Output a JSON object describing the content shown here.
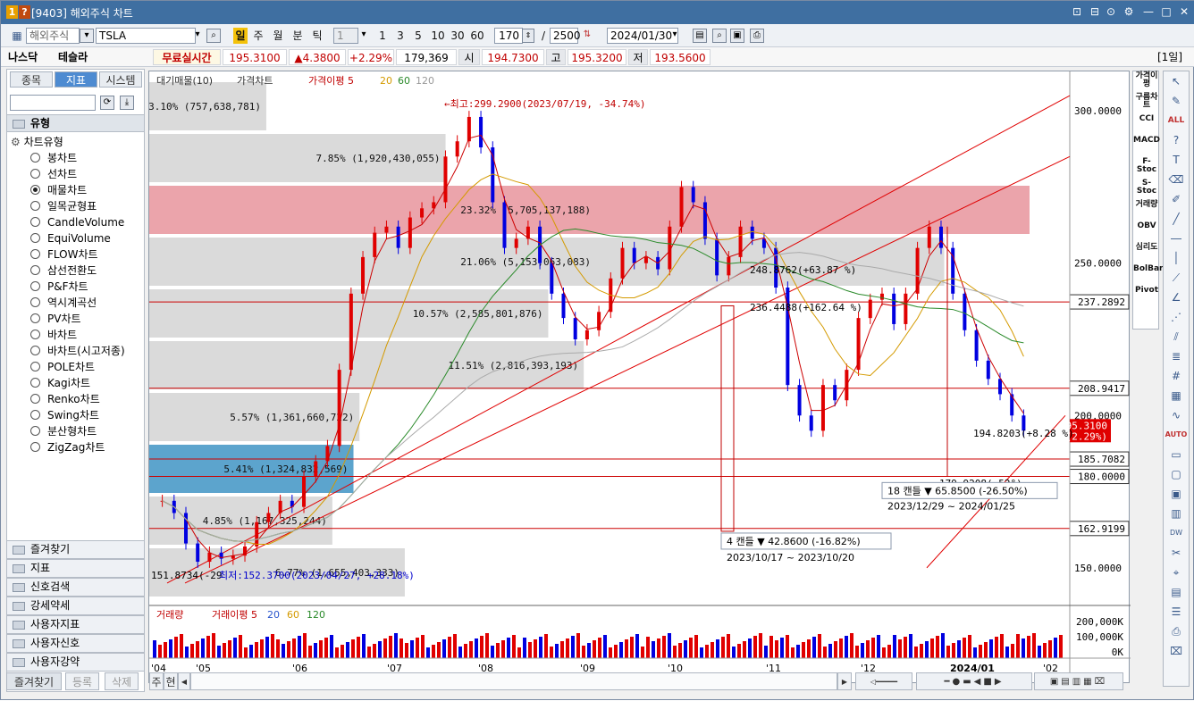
{
  "window": {
    "title": "[9403] 해외주식 차트",
    "badge1": "1",
    "badge2": "?",
    "controls": [
      "⊡",
      "⊟",
      "⊙",
      "⚙",
      "—",
      "□",
      "✕"
    ]
  },
  "toolbar": {
    "market": "해외주식",
    "symbol": "TSLA",
    "period_btn": "일",
    "periods": [
      "주",
      "월",
      "분",
      "틱"
    ],
    "count_sel": "1",
    "nums": [
      "1",
      "3",
      "5",
      "10",
      "30",
      "60"
    ],
    "view": "170",
    "total": "2500",
    "date": "2024/01/30"
  },
  "quote": {
    "exchange": "나스닥",
    "name": "테슬라",
    "realtime": "무료실시간",
    "price": "195.3100",
    "change": "▲4.3800",
    "pct": "+2.29%",
    "volume": "179,369",
    "open_lbl": "시",
    "open": "194.7300",
    "high_lbl": "고",
    "high": "195.3200",
    "low_lbl": "저",
    "low": "193.5600",
    "interval": "[1일]"
  },
  "left": {
    "tabs": [
      "종목",
      "지표",
      "시스템"
    ],
    "group": "유형",
    "root": "차트유형",
    "types": [
      "봉차트",
      "선차트",
      "매물차트",
      "일목균형표",
      "CandleVolume",
      "EquiVolume",
      "FLOW차트",
      "삼선전환도",
      "P&F차트",
      "역시계곡선",
      "PV차트",
      "바차트",
      "바차트(시고저종)",
      "POLE차트",
      "Kagi차트",
      "Renko차트",
      "Swing차트",
      "분산형차트",
      "ZigZag차트"
    ],
    "selected": 2,
    "menus": [
      "즐겨찾기",
      "지표",
      "신호검색",
      "강세약세",
      "사용자지표",
      "사용자신호",
      "사용자강약"
    ]
  },
  "chart_data": {
    "type": "candlestick",
    "legend_top": [
      "대기매물(10)",
      "가격차트",
      "가격이평 5",
      "20",
      "60",
      "120"
    ],
    "legend_bottom": [
      "거래량",
      "거래이평 5",
      "20",
      "60",
      "120"
    ],
    "price_axis": [
      "300.0000",
      "250.0000",
      "200.0000",
      "150.0000"
    ],
    "price_tags": [
      {
        "label": "237.2892",
        "v": 237.29
      },
      {
        "label": "208.9417",
        "v": 208.94
      },
      {
        "label": "185.7082",
        "v": 185.71
      },
      {
        "label": "180.0000",
        "v": 180
      },
      {
        "label": "162.9199",
        "v": 162.92
      }
    ],
    "current_price": "195.3100",
    "current_pct": "(2.29%)",
    "volume_axis": [
      "200,000K",
      "100,000K",
      "0K"
    ],
    "x_labels": [
      "'04",
      "'05",
      "'06",
      "'07",
      "'08",
      "'09",
      "'10",
      "'11",
      "'12",
      "2024/01",
      "'02"
    ],
    "profile": [
      {
        "label": "6.77% (1,655,403,333)",
        "pct": 6.77
      },
      {
        "label": "4.85% (1,167,325,244)",
        "pct": 4.85
      },
      {
        "label": "5.41% (1,324,832,569)",
        "pct": 5.41
      },
      {
        "label": "5.57% (1,361,660,722)",
        "pct": 5.57
      },
      {
        "label": "11.51% (2,816,393,193)",
        "pct": 11.51
      },
      {
        "label": "10.57% (2,585,801,876)",
        "pct": 10.57
      },
      {
        "label": "21.06% (5,153,063,083)",
        "pct": 21.06
      },
      {
        "label": "23.32% (5,705,137,188)",
        "pct": 23.32
      },
      {
        "label": "7.85% (1,920,430,055)",
        "pct": 7.85
      },
      {
        "label": "3.10% (757,638,781)",
        "pct": 3.1
      }
    ],
    "annotations": {
      "high": "←최고:299.2900(2023/07/19, -34.74%)",
      "low": "151.8734(-29",
      "low2": "최저:152.3700(2023/04/27, +28.18%)",
      "p1": "248.8762(+63.87 %)",
      "p2": "236.4488(+162.64 %)",
      "p3": "194.8203(+8.28 %)",
      "p4": "179.9208(-52°)",
      "box1a": "4 캔들  ▼ 42.8600 (-16.82%)",
      "box1b": "2023/10/17 ~ 2023/10/20",
      "box2a": "18 캔들  ▼ 65.8500 (-26.50%)",
      "box2b": "2023/12/29 ~ 2024/01/25"
    },
    "prices": [
      172,
      168,
      158,
      152,
      155,
      153,
      154,
      157,
      165,
      168,
      172,
      170,
      180,
      185,
      190,
      215,
      240,
      252,
      260,
      262,
      255,
      265,
      268,
      270,
      285,
      290,
      298,
      288,
      270,
      255,
      258,
      262,
      250,
      240,
      232,
      225,
      228,
      234,
      245,
      255,
      250,
      252,
      248,
      262,
      275,
      270,
      258,
      246,
      252,
      262,
      258,
      255,
      242,
      210,
      200,
      195,
      210,
      205,
      215,
      232,
      238,
      240,
      230,
      240,
      255,
      262,
      255,
      240,
      228,
      218,
      212,
      207,
      200,
      195
    ]
  },
  "bottom": {
    "left_btns": [
      "즐겨찾기",
      "등록",
      "삭제"
    ],
    "pager": [
      "주",
      "현"
    ]
  },
  "right_tools": [
    "가격이평",
    "구름차트",
    "CCI",
    "MACD",
    "F-Stoc",
    "S-Stoc",
    "거래량",
    "OBV",
    "심리도",
    "BolBand",
    "Pivot"
  ],
  "colors": {
    "title": "#3f6fa1",
    "up": "#e00000",
    "down": "#0000e0",
    "zone_red": "#e99aa2",
    "zone_blue": "#4a9ac8",
    "zone_gray": "#d6d6d6"
  }
}
